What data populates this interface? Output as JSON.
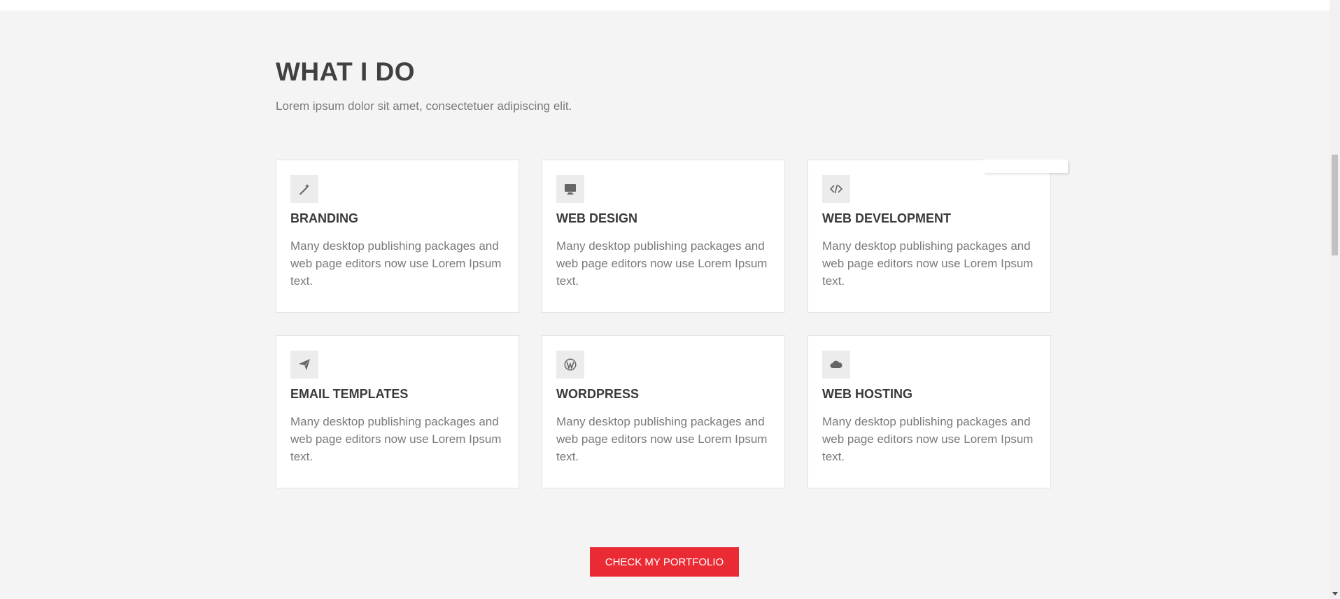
{
  "section": {
    "heading": "WHAT I DO",
    "subheading": "Lorem ipsum dolor sit amet, consectetuer adipiscing elit."
  },
  "services": [
    {
      "icon": "magic-wand-icon",
      "title": "BRANDING",
      "text": "Many desktop publishing packages and web page editors now use Lorem Ipsum text."
    },
    {
      "icon": "desktop-icon",
      "title": "WEB DESIGN",
      "text": "Many desktop publishing packages and web page editors now use Lorem Ipsum text."
    },
    {
      "icon": "code-icon",
      "title": "WEB DEVELOPMENT",
      "text": "Many desktop publishing packages and web page editors now use Lorem Ipsum text."
    },
    {
      "icon": "paper-plane-icon",
      "title": "EMAIL TEMPLATES",
      "text": "Many desktop publishing packages and web page editors now use Lorem Ipsum text."
    },
    {
      "icon": "wordpress-icon",
      "title": "WORDPRESS",
      "text": "Many desktop publishing packages and web page editors now use Lorem Ipsum text."
    },
    {
      "icon": "cloud-icon",
      "title": "WEB HOSTING",
      "text": "Many desktop publishing packages and web page editors now use Lorem Ipsum text."
    }
  ],
  "cta": {
    "label": "CHECK MY PORTFOLIO"
  },
  "colors": {
    "accent": "#ea2b33",
    "background": "#f4f4f4",
    "card": "#ffffff",
    "heading": "#404040",
    "text": "#7a7a7a"
  }
}
